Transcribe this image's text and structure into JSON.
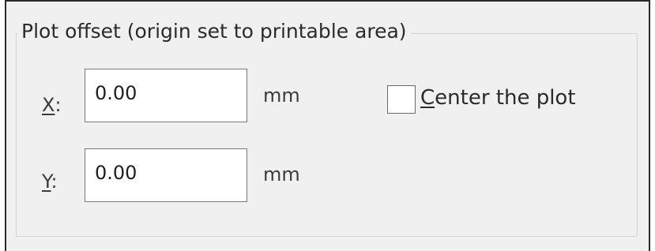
{
  "group": {
    "title": "Plot offset (origin set to printable area)"
  },
  "x_row": {
    "label_mnemonic": "X",
    "label_rest": ":",
    "value": "0.00",
    "unit": "mm"
  },
  "y_row": {
    "label_mnemonic": "Y",
    "label_rest": ":",
    "value": "0.00",
    "unit": "mm"
  },
  "center_plot": {
    "label_mnemonic": "C",
    "label_rest": "enter the plot",
    "checked": false
  }
}
